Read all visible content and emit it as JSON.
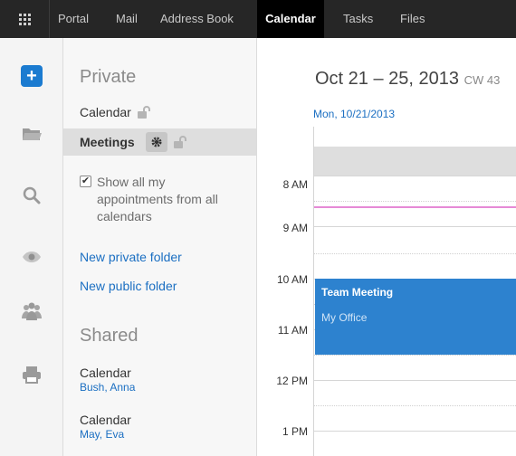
{
  "topnav": {
    "items": [
      {
        "label": "Portal",
        "active": false
      },
      {
        "label": "Mail",
        "active": false
      },
      {
        "label": "Address Book",
        "active": false
      },
      {
        "label": "Calendar",
        "active": true
      },
      {
        "label": "Tasks",
        "active": false
      },
      {
        "label": "Files",
        "active": false
      }
    ]
  },
  "rail": {
    "icons": [
      "add-icon",
      "folder-icon",
      "search-icon",
      "eye-icon",
      "users-icon",
      "print-icon"
    ]
  },
  "tree": {
    "private_heading": "Private",
    "private_folders": [
      {
        "label": "Calendar",
        "selected": false
      },
      {
        "label": "Meetings",
        "selected": true
      }
    ],
    "show_all": {
      "label": "Show all my appointments from all calendars",
      "checked": true
    },
    "new_private_folder": "New private folder",
    "new_public_folder": "New public folder",
    "shared_heading": "Shared",
    "shared": [
      {
        "name": "Calendar",
        "owner": "Bush, Anna"
      },
      {
        "name": "Calendar",
        "owner": "May, Eva"
      }
    ]
  },
  "calendar": {
    "range": "Oct 21 – 25, 2013",
    "week": "CW 43",
    "day_header": "Mon, 10/21/2013",
    "times": [
      "8 AM",
      "9 AM",
      "10 AM",
      "11 AM",
      "12 PM",
      "1 PM"
    ],
    "appointment": {
      "title": "Team Meeting",
      "location": "My Office"
    }
  },
  "colors": {
    "accent": "#1b7bd0",
    "appointment": "#2d82cf",
    "current_time": "#e68ad6",
    "topbar": "#262626"
  }
}
